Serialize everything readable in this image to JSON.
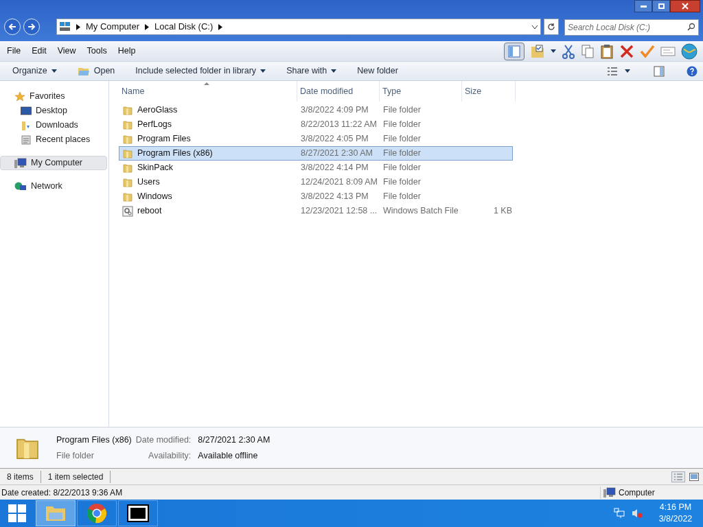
{
  "address": {
    "crumbs": [
      "My Computer",
      "Local Disk (C:)"
    ]
  },
  "search": {
    "placeholder": "Search Local Disk (C:)"
  },
  "menu": [
    "File",
    "Edit",
    "View",
    "Tools",
    "Help"
  ],
  "commands": [
    {
      "label": "Organize",
      "dropdown": true,
      "kind": "text"
    },
    {
      "label": "Open",
      "dropdown": false,
      "kind": "open"
    },
    {
      "label": "Include selected folder in library",
      "dropdown": true,
      "kind": "text"
    },
    {
      "label": "Share with",
      "dropdown": true,
      "kind": "text"
    },
    {
      "label": "New folder",
      "dropdown": false,
      "kind": "text"
    }
  ],
  "sidebar": [
    {
      "label": "Favorites",
      "kind": "star",
      "selected": false,
      "children": [
        {
          "label": "Desktop",
          "kind": "desktop",
          "selected": false
        },
        {
          "label": "Downloads",
          "kind": "downloads",
          "selected": false
        },
        {
          "label": "Recent places",
          "kind": "recent",
          "selected": false
        }
      ]
    },
    {
      "label": "My Computer",
      "kind": "computer",
      "selected": true
    },
    {
      "label": "Network",
      "kind": "network",
      "selected": false
    }
  ],
  "columns": [
    "Name",
    "Date modified",
    "Type",
    "Size"
  ],
  "rows": [
    {
      "name": "AeroGlass",
      "date": "3/8/2022 4:09 PM",
      "type": "File folder",
      "kind": "folder",
      "selected": false
    },
    {
      "name": "PerfLogs",
      "date": "8/22/2013 11:22 AM",
      "type": "File folder",
      "kind": "folder",
      "selected": false
    },
    {
      "name": "Program Files",
      "date": "3/8/2022 4:05 PM",
      "type": "File folder",
      "kind": "folder",
      "selected": false
    },
    {
      "name": "Program Files (x86)",
      "date": "8/27/2021 2:30 AM",
      "type": "File folder",
      "kind": "folder",
      "selected": true
    },
    {
      "name": "SkinPack",
      "date": "3/8/2022 4:14 PM",
      "type": "File folder",
      "kind": "folder",
      "selected": false
    },
    {
      "name": "Users",
      "date": "12/24/2021 8:09 AM",
      "type": "File folder",
      "kind": "folder",
      "selected": false
    },
    {
      "name": "Windows",
      "date": "3/8/2022 4:13 PM",
      "type": "File folder",
      "kind": "folder",
      "selected": false
    },
    {
      "name": "reboot",
      "date": "12/23/2021 12:58 ...",
      "type": "Windows Batch File",
      "size": "1 KB",
      "kind": "batch",
      "selected": false
    }
  ],
  "details": {
    "name": "Program Files (x86)",
    "type": "File folder",
    "fields": [
      {
        "label": "Date modified:",
        "value": "8/27/2021 2:30 AM"
      },
      {
        "label": "Availability:",
        "value": "Available offline"
      }
    ]
  },
  "status": [
    "8 items",
    "1 item selected"
  ],
  "bottom_status": {
    "text": "Date created: 8/22/2013 9:36 AM",
    "location": "Computer"
  },
  "clock": {
    "time": "4:16 PM",
    "date": "3/8/2022"
  }
}
